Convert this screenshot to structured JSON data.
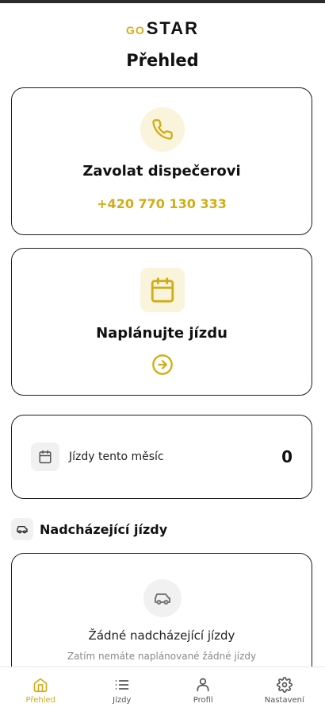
{
  "header": {
    "logo_go": "GO",
    "logo_star": "STAR",
    "page_title": "Přehled"
  },
  "call_card": {
    "title": "Zavolat dispečerovi",
    "phone": "+420 770 130 333",
    "icon": "phone-icon"
  },
  "plan_card": {
    "title": "Naplánujte jízdu",
    "icon": "calendar-icon",
    "action_icon": "arrow-right-circle-icon"
  },
  "stats": {
    "label": "Jízdy tento měsíc",
    "value": "0",
    "icon": "calendar-icon"
  },
  "upcoming": {
    "title": "Nadcházející jízdy",
    "icon": "car-icon",
    "empty_title": "Žádné nadcházející jízdy",
    "empty_subtitle": "Zatím nemáte naplánované žádné jízdy"
  },
  "nav": {
    "items": [
      {
        "label": "Přehled",
        "icon": "home-icon",
        "active": true
      },
      {
        "label": "Jízdy",
        "icon": "list-icon",
        "active": false
      },
      {
        "label": "Profil",
        "icon": "user-icon",
        "active": false
      },
      {
        "label": "Nastavení",
        "icon": "gear-icon",
        "active": false
      }
    ]
  },
  "colors": {
    "accent": "#d2ad15",
    "accent_bg": "#faf4dd",
    "border": "#1e1e1e"
  }
}
